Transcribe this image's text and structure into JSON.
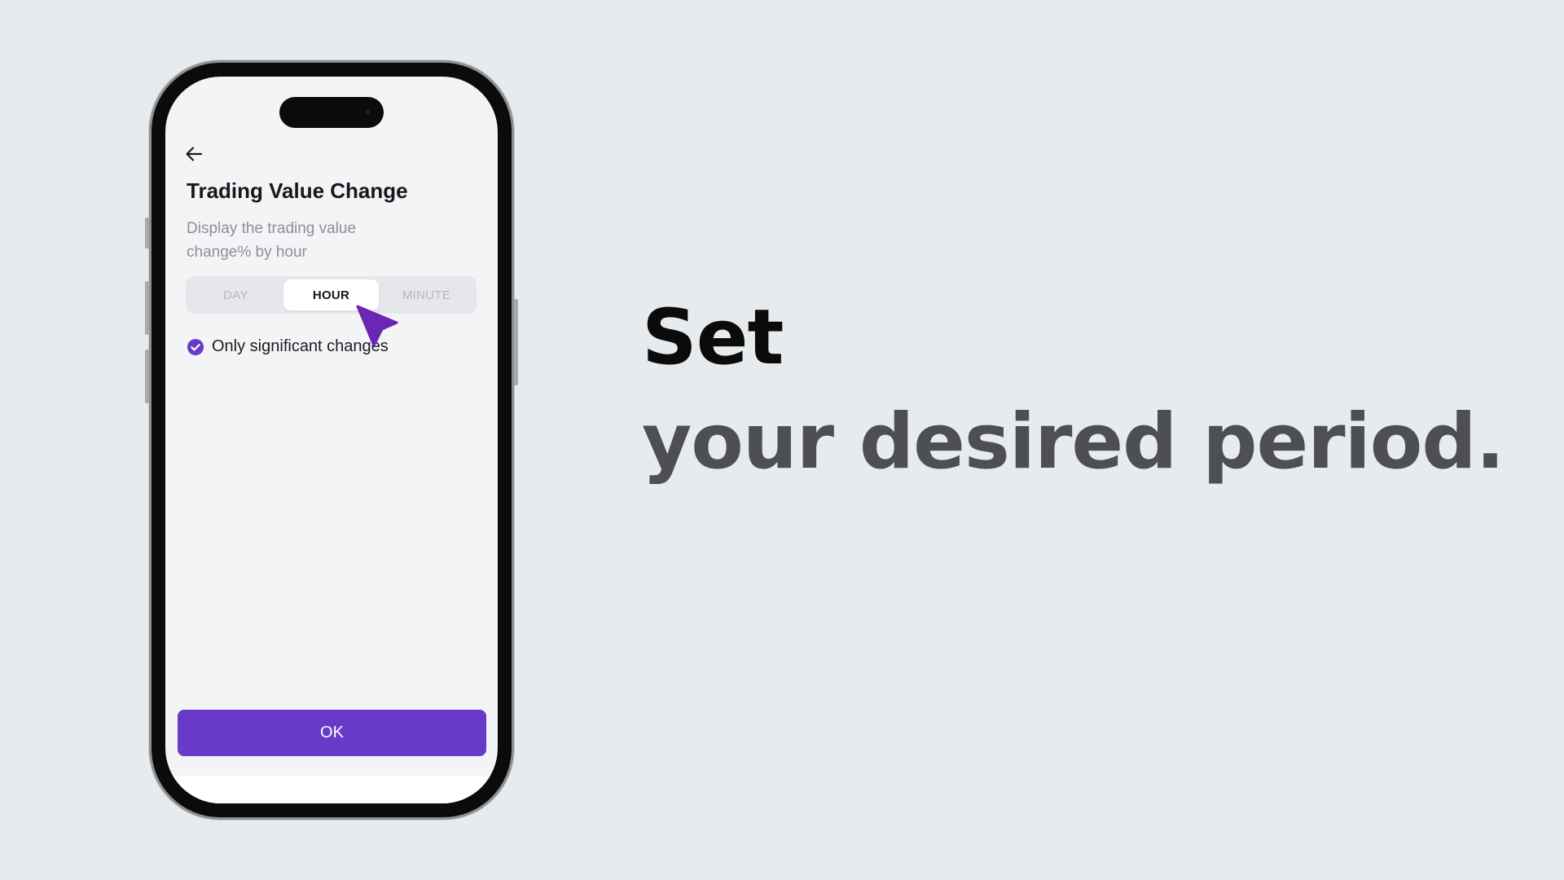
{
  "app": {
    "back_icon": "arrow-left-icon",
    "title": "Trading Value Change",
    "subtitle": "Display the trading value change% by hour",
    "period_tabs": [
      {
        "label": "DAY",
        "selected": false
      },
      {
        "label": "HOUR",
        "selected": true
      },
      {
        "label": "MINUTE",
        "selected": false
      }
    ],
    "filter": {
      "label": "Only significant changes",
      "checked": true,
      "icon": "check-circle-icon"
    },
    "ok_label": "OK",
    "accent_color": "#673ac7"
  },
  "cursor": {
    "icon": "pointer-cursor-icon",
    "color": "#6a26b5"
  },
  "headline": {
    "line1": "Set",
    "line2": "your desired period."
  }
}
